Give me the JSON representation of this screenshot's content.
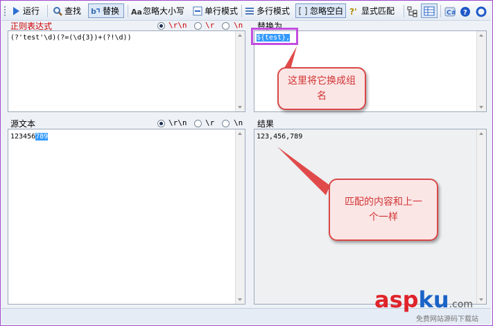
{
  "toolbar": {
    "run": "运行",
    "find": "查找",
    "replace": "替换",
    "ignore_case": "忽略大小写",
    "single_line": "单行模式",
    "multi_line": "多行模式",
    "ignore_whitespace": "忽略空白",
    "explicit_capture": "显式匹配"
  },
  "regex_section": {
    "title": "正则表达式",
    "newline_options": [
      "\\r\\n",
      "\\r",
      "\\n"
    ],
    "selected": "\\r\\n",
    "value": "(?'test'\\d)(?=(\\d{3})+(?!\\d))"
  },
  "replace_section": {
    "title": "替换为",
    "value": "${test},"
  },
  "source_section": {
    "title": "源文本",
    "newline_options": [
      "\\r\\n",
      "\\r",
      "\\n"
    ],
    "selected": "\\r\\n",
    "value_plain": "123456",
    "value_selected": "789"
  },
  "result_section": {
    "title": "结果",
    "value": "123,456,789"
  },
  "annotations": {
    "callout_top": "这里将它换成组名",
    "callout_bottom": "匹配的内容和上一个一样",
    "colors": {
      "callout_border": "#d94848",
      "highlight_box": "#c44ce0",
      "arrow": "#e04a4a"
    }
  },
  "watermark": {
    "brand_red": "asp",
    "brand_blue": "ku",
    "brand_tld": ".com",
    "tagline": "免费网站源码下载站"
  }
}
